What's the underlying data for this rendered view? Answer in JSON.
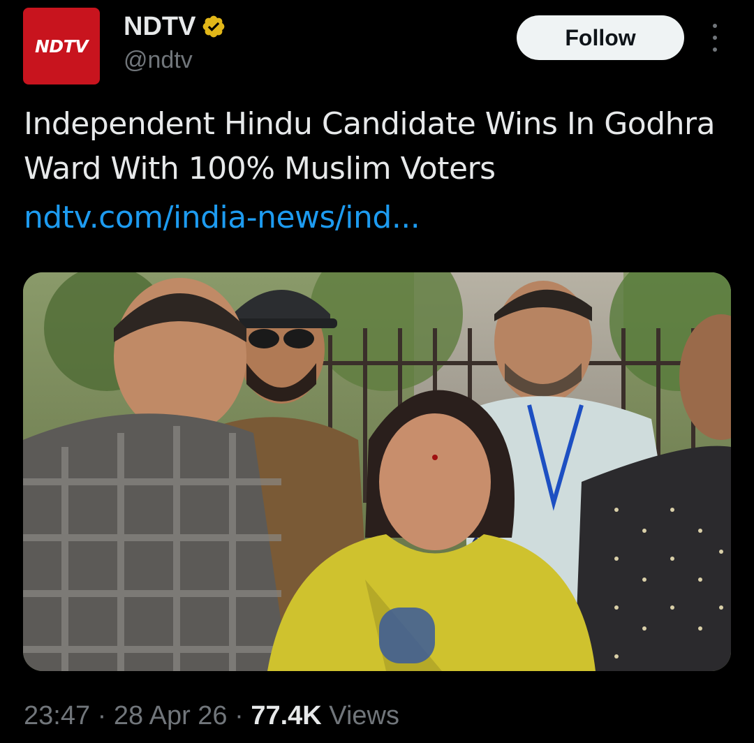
{
  "author": {
    "avatar_logo_text": "NDTV",
    "avatar_color": "#c8141e",
    "display_name": "NDTV",
    "handle": "@ndtv",
    "verified_badge_color": "#e2b719"
  },
  "actions": {
    "follow_label": "Follow"
  },
  "tweet": {
    "text": "Independent Hindu Candidate Wins In Godhra Ward With 100% Muslim Voters",
    "link_text": "ndtv.com/india-news/ind..."
  },
  "meta": {
    "time": "23:47",
    "separator1": " · ",
    "date": "28 Apr 26",
    "separator2": " · ",
    "views_count": "77.4K",
    "views_label": " Views"
  },
  "colors": {
    "background": "#000000",
    "text_primary": "#e7e9ea",
    "text_secondary": "#71767b",
    "link": "#1d9bf0",
    "follow_button_bg": "#eff3f4"
  }
}
